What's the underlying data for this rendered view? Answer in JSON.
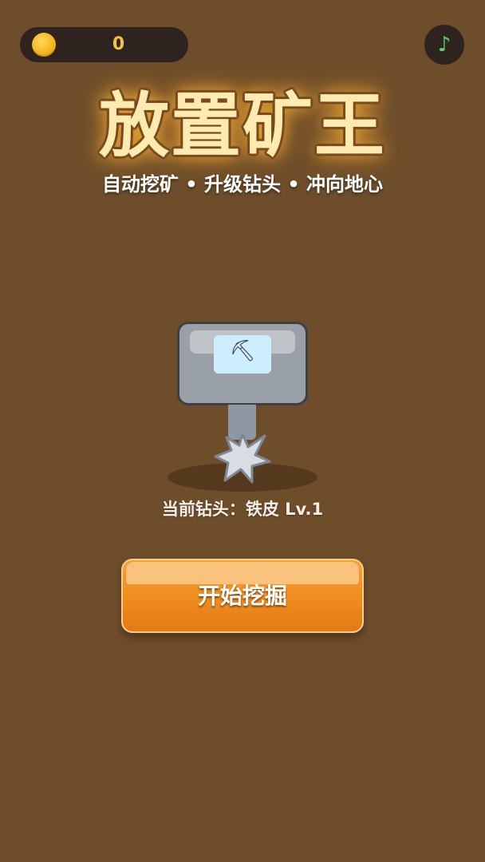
{
  "hud": {
    "coins": "0",
    "music_icon": "♪"
  },
  "title": {
    "main": "放置矿王",
    "subtitle": "自动挖矿 • 升级钻头 • 冲向地心"
  },
  "drill": {
    "window_icon": "⛏",
    "current_label": "当前钻头：铁皮 Lv.1"
  },
  "actions": {
    "start_label": "开始挖掘"
  },
  "colors": {
    "background": "#6e4d2b",
    "coin_text": "#f7c33e",
    "music_icon": "#62d46a",
    "start_button": "#ef8c1f"
  }
}
